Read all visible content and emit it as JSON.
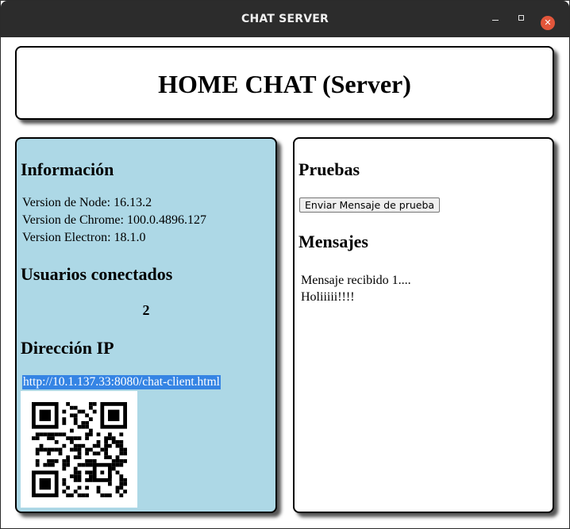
{
  "window": {
    "title": "CHAT SERVER",
    "controls": {
      "minimize": "",
      "maximize": "",
      "close": "✕"
    }
  },
  "header": {
    "title": "HOME CHAT (Server)"
  },
  "info": {
    "heading": "Información",
    "node_version": "Version de Node: 16.13.2",
    "chrome_version": "Version de Chrome: 100.0.4896.127",
    "electron_version": "Version Electron: 18.1.0"
  },
  "users": {
    "heading": "Usuarios conectados",
    "count": "2"
  },
  "ip": {
    "heading": "Dirección IP",
    "url": "http://10.1.137.33:8080/chat-client.html"
  },
  "tests": {
    "heading": "Pruebas",
    "button_label": "Enviar Mensaje de prueba"
  },
  "messages": {
    "heading": "Mensajes",
    "items": [
      "Mensaje recibido 1....",
      "Holiiiii!!!!"
    ]
  },
  "colors": {
    "titlebar": "#2c2c2c",
    "left_panel": "#add8e6",
    "close_button": "#e2563b",
    "selection": "#3584e4"
  },
  "icons": {
    "minimize": "minimize-icon",
    "maximize": "maximize-icon",
    "close": "close-icon",
    "qr": "qr-code-icon"
  }
}
